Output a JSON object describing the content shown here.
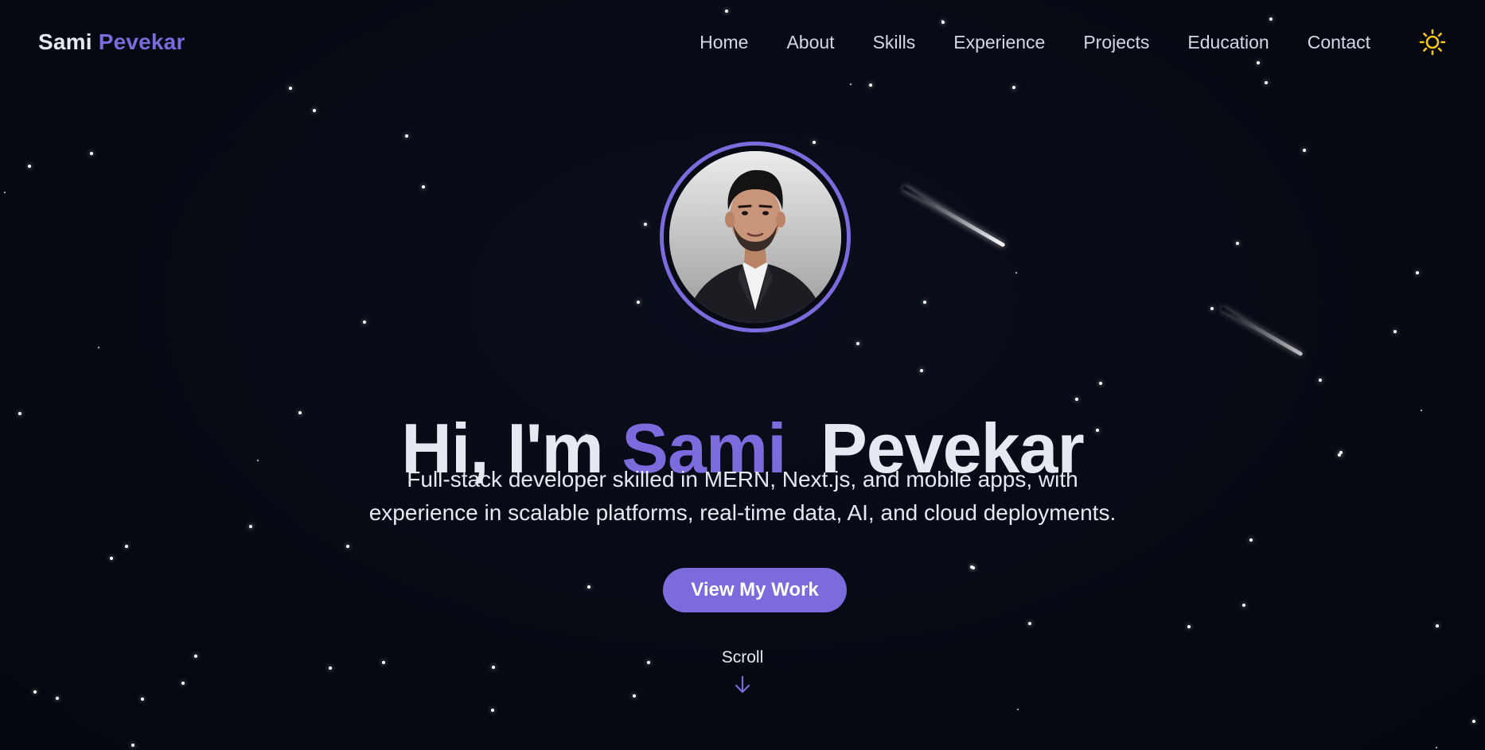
{
  "brand": {
    "first": "Sami",
    "last": "Pevekar"
  },
  "nav": {
    "items": [
      {
        "label": "Home"
      },
      {
        "label": "About"
      },
      {
        "label": "Skills"
      },
      {
        "label": "Experience"
      },
      {
        "label": "Projects"
      },
      {
        "label": "Education"
      },
      {
        "label": "Contact"
      }
    ],
    "theme_toggle_icon": "sun-icon"
  },
  "hero": {
    "avatar_icon": "profile-photo",
    "greeting": "Hi, I'm",
    "name_first": "Sami",
    "name_last": "Pevekar",
    "tagline_line1": "Full-stack developer skilled in MERN, Next.js, and mobile apps, with",
    "tagline_line2": "experience in scalable platforms, real-time data, AI, and cloud deployments.",
    "cta_label": "View My Work",
    "scroll_label": "Scroll",
    "scroll_icon": "arrow-down-icon"
  },
  "colors": {
    "background": "#070913",
    "accent": "#7b6bdc",
    "text": "#e6e9f2",
    "sun": "#f5c518"
  }
}
